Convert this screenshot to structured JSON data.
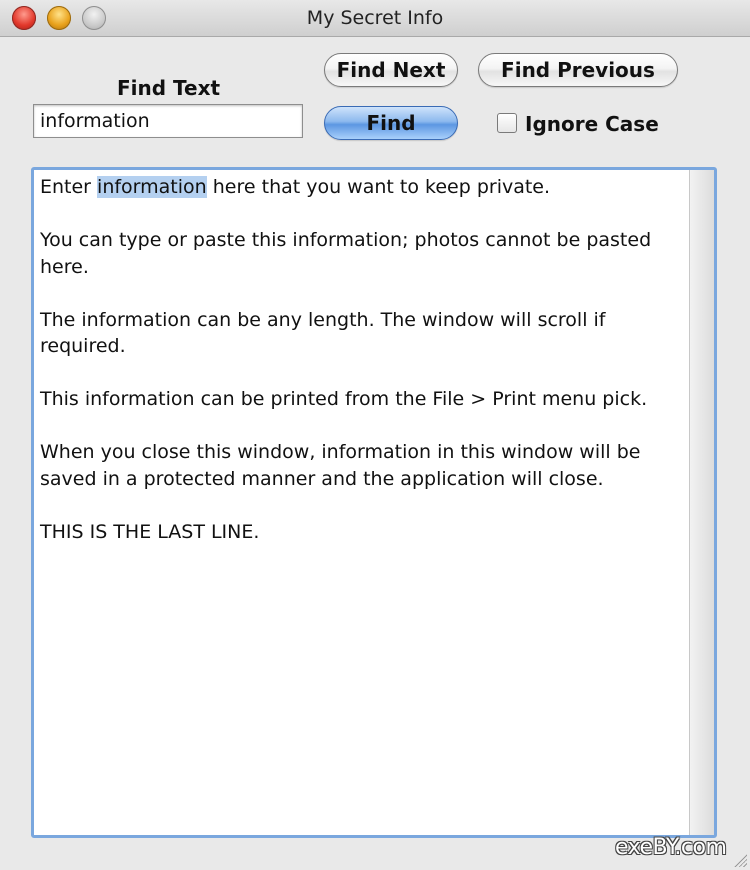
{
  "window": {
    "title": "My Secret Info"
  },
  "find": {
    "label": "Find Text",
    "value": "information",
    "find_next_label": "Find Next",
    "find_previous_label": "Find Previous",
    "find_label": "Find",
    "ignore_case_label": "Ignore Case",
    "ignore_case_checked": false
  },
  "content": {
    "p1_highlight": "information",
    "p1_before": "Enter ",
    "p1_after": " here that you want to keep private.",
    "p2": "You can type or paste this information; photos cannot be pasted here.",
    "p3": "The information can be any length.  The window will scroll if required.",
    "p4": "This information can be printed from the File > Print menu pick.",
    "p5": "When you close this window, information in this window will be saved in a protected manner and the application will close.",
    "p6": "THIS IS THE LAST LINE."
  },
  "watermark": "exeBY.com",
  "colors": {
    "find_button": "#5c97e2",
    "selection_highlight": "#b4d0f0",
    "focus_ring": "#7aa7de"
  }
}
